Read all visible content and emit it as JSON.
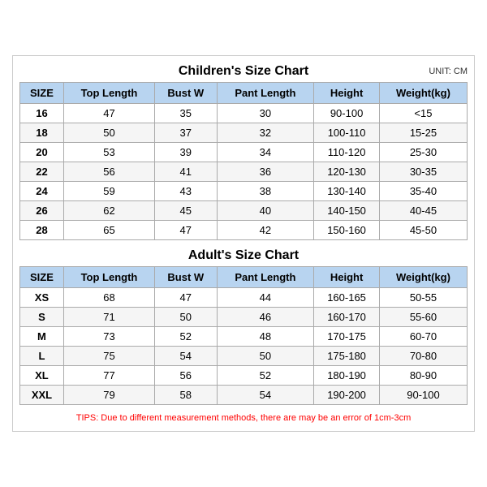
{
  "children_title": "Children's Size Chart",
  "adult_title": "Adult's Size Chart",
  "unit_label": "UNIT: CM",
  "headers": [
    "SIZE",
    "Top Length",
    "Bust W",
    "Pant Length",
    "Height",
    "Weight(kg)"
  ],
  "children_rows": [
    [
      "16",
      "47",
      "35",
      "30",
      "90-100",
      "<15"
    ],
    [
      "18",
      "50",
      "37",
      "32",
      "100-110",
      "15-25"
    ],
    [
      "20",
      "53",
      "39",
      "34",
      "110-120",
      "25-30"
    ],
    [
      "22",
      "56",
      "41",
      "36",
      "120-130",
      "30-35"
    ],
    [
      "24",
      "59",
      "43",
      "38",
      "130-140",
      "35-40"
    ],
    [
      "26",
      "62",
      "45",
      "40",
      "140-150",
      "40-45"
    ],
    [
      "28",
      "65",
      "47",
      "42",
      "150-160",
      "45-50"
    ]
  ],
  "adult_rows": [
    [
      "XS",
      "68",
      "47",
      "44",
      "160-165",
      "50-55"
    ],
    [
      "S",
      "71",
      "50",
      "46",
      "160-170",
      "55-60"
    ],
    [
      "M",
      "73",
      "52",
      "48",
      "170-175",
      "60-70"
    ],
    [
      "L",
      "75",
      "54",
      "50",
      "175-180",
      "70-80"
    ],
    [
      "XL",
      "77",
      "56",
      "52",
      "180-190",
      "80-90"
    ],
    [
      "XXL",
      "79",
      "58",
      "54",
      "190-200",
      "90-100"
    ]
  ],
  "tips": "TIPS: Due to different measurement methods, there are may be an error of 1cm-3cm"
}
